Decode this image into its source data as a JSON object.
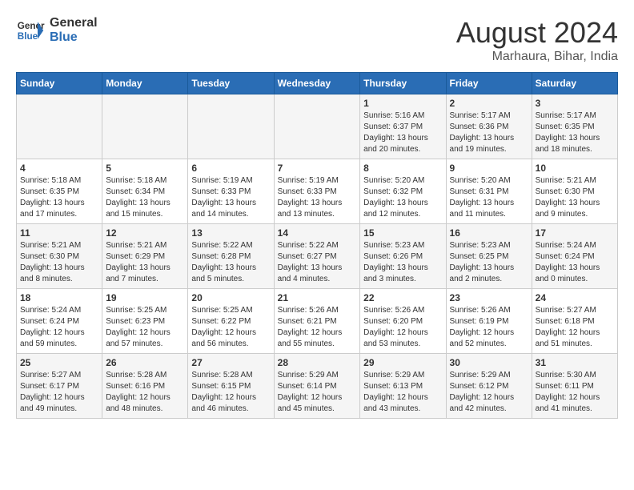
{
  "logo": {
    "line1": "General",
    "line2": "Blue"
  },
  "title": "August 2024",
  "location": "Marhaura, Bihar, India",
  "days_of_week": [
    "Sunday",
    "Monday",
    "Tuesday",
    "Wednesday",
    "Thursday",
    "Friday",
    "Saturday"
  ],
  "weeks": [
    [
      {
        "day": "",
        "info": ""
      },
      {
        "day": "",
        "info": ""
      },
      {
        "day": "",
        "info": ""
      },
      {
        "day": "",
        "info": ""
      },
      {
        "day": "1",
        "sunrise": "5:16 AM",
        "sunset": "6:37 PM",
        "daylight": "13 hours and 20 minutes."
      },
      {
        "day": "2",
        "sunrise": "5:17 AM",
        "sunset": "6:36 PM",
        "daylight": "13 hours and 19 minutes."
      },
      {
        "day": "3",
        "sunrise": "5:17 AM",
        "sunset": "6:35 PM",
        "daylight": "13 hours and 18 minutes."
      }
    ],
    [
      {
        "day": "4",
        "sunrise": "5:18 AM",
        "sunset": "6:35 PM",
        "daylight": "13 hours and 17 minutes."
      },
      {
        "day": "5",
        "sunrise": "5:18 AM",
        "sunset": "6:34 PM",
        "daylight": "13 hours and 15 minutes."
      },
      {
        "day": "6",
        "sunrise": "5:19 AM",
        "sunset": "6:33 PM",
        "daylight": "13 hours and 14 minutes."
      },
      {
        "day": "7",
        "sunrise": "5:19 AM",
        "sunset": "6:33 PM",
        "daylight": "13 hours and 13 minutes."
      },
      {
        "day": "8",
        "sunrise": "5:20 AM",
        "sunset": "6:32 PM",
        "daylight": "13 hours and 12 minutes."
      },
      {
        "day": "9",
        "sunrise": "5:20 AM",
        "sunset": "6:31 PM",
        "daylight": "13 hours and 11 minutes."
      },
      {
        "day": "10",
        "sunrise": "5:21 AM",
        "sunset": "6:30 PM",
        "daylight": "13 hours and 9 minutes."
      }
    ],
    [
      {
        "day": "11",
        "sunrise": "5:21 AM",
        "sunset": "6:30 PM",
        "daylight": "13 hours and 8 minutes."
      },
      {
        "day": "12",
        "sunrise": "5:21 AM",
        "sunset": "6:29 PM",
        "daylight": "13 hours and 7 minutes."
      },
      {
        "day": "13",
        "sunrise": "5:22 AM",
        "sunset": "6:28 PM",
        "daylight": "13 hours and 5 minutes."
      },
      {
        "day": "14",
        "sunrise": "5:22 AM",
        "sunset": "6:27 PM",
        "daylight": "13 hours and 4 minutes."
      },
      {
        "day": "15",
        "sunrise": "5:23 AM",
        "sunset": "6:26 PM",
        "daylight": "13 hours and 3 minutes."
      },
      {
        "day": "16",
        "sunrise": "5:23 AM",
        "sunset": "6:25 PM",
        "daylight": "13 hours and 2 minutes."
      },
      {
        "day": "17",
        "sunrise": "5:24 AM",
        "sunset": "6:24 PM",
        "daylight": "13 hours and 0 minutes."
      }
    ],
    [
      {
        "day": "18",
        "sunrise": "5:24 AM",
        "sunset": "6:24 PM",
        "daylight": "12 hours and 59 minutes."
      },
      {
        "day": "19",
        "sunrise": "5:25 AM",
        "sunset": "6:23 PM",
        "daylight": "12 hours and 57 minutes."
      },
      {
        "day": "20",
        "sunrise": "5:25 AM",
        "sunset": "6:22 PM",
        "daylight": "12 hours and 56 minutes."
      },
      {
        "day": "21",
        "sunrise": "5:26 AM",
        "sunset": "6:21 PM",
        "daylight": "12 hours and 55 minutes."
      },
      {
        "day": "22",
        "sunrise": "5:26 AM",
        "sunset": "6:20 PM",
        "daylight": "12 hours and 53 minutes."
      },
      {
        "day": "23",
        "sunrise": "5:26 AM",
        "sunset": "6:19 PM",
        "daylight": "12 hours and 52 minutes."
      },
      {
        "day": "24",
        "sunrise": "5:27 AM",
        "sunset": "6:18 PM",
        "daylight": "12 hours and 51 minutes."
      }
    ],
    [
      {
        "day": "25",
        "sunrise": "5:27 AM",
        "sunset": "6:17 PM",
        "daylight": "12 hours and 49 minutes."
      },
      {
        "day": "26",
        "sunrise": "5:28 AM",
        "sunset": "6:16 PM",
        "daylight": "12 hours and 48 minutes."
      },
      {
        "day": "27",
        "sunrise": "5:28 AM",
        "sunset": "6:15 PM",
        "daylight": "12 hours and 46 minutes."
      },
      {
        "day": "28",
        "sunrise": "5:29 AM",
        "sunset": "6:14 PM",
        "daylight": "12 hours and 45 minutes."
      },
      {
        "day": "29",
        "sunrise": "5:29 AM",
        "sunset": "6:13 PM",
        "daylight": "12 hours and 43 minutes."
      },
      {
        "day": "30",
        "sunrise": "5:29 AM",
        "sunset": "6:12 PM",
        "daylight": "12 hours and 42 minutes."
      },
      {
        "day": "31",
        "sunrise": "5:30 AM",
        "sunset": "6:11 PM",
        "daylight": "12 hours and 41 minutes."
      }
    ]
  ]
}
